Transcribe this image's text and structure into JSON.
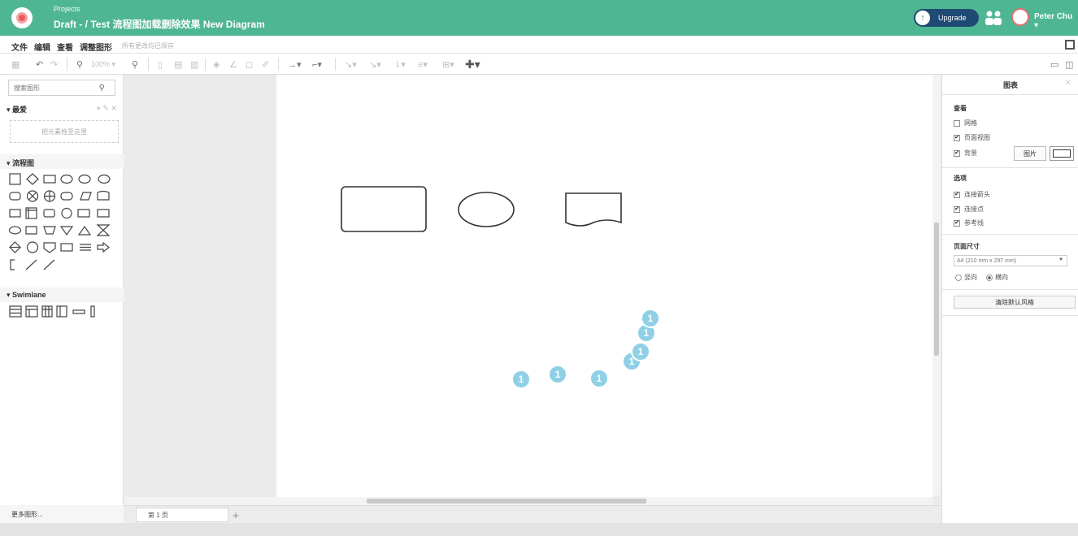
{
  "header": {
    "projects_label": "Projects",
    "doc_title": "Draft - / Test 流程图加载删除效果 New Diagram",
    "upgrade_label": "Upgrade",
    "user_name": "Peter Chu"
  },
  "menubar": {
    "items": [
      "文件",
      "编辑",
      "查看",
      "调整图形"
    ],
    "save_status": "所有更改均已保存"
  },
  "toolbar": {
    "zoom": "100%"
  },
  "sidebar": {
    "search_placeholder": "搜索图形",
    "favorites_title": "最爱",
    "drop_hint": "把元素拖至这里",
    "flowchart_title": "流程图",
    "swimlane_title": "Swimlane",
    "more_shapes": "更多图形..."
  },
  "pagebar": {
    "page_tab": "第 1 页",
    "add_page": "+"
  },
  "format_panel": {
    "title": "图表",
    "view_label": "查看",
    "grid_label": "网格",
    "page_view_label": "页面视图",
    "background_label": "背景",
    "image_button": "图片",
    "options_label": "选项",
    "connection_arrows_label": "连接箭头",
    "connection_points_label": "连接点",
    "guides_label": "参考线",
    "page_size_label": "页面尺寸",
    "page_size_value": "A4 (210 mm x 297 mm)",
    "portrait_label": "竖向",
    "landscape_label": "横向",
    "reset_style_button": "清除默认风格",
    "checks": {
      "grid": false,
      "page_view": true,
      "background": true,
      "connection_arrows": true,
      "connection_points": true,
      "guides": true
    },
    "orientation": "landscape"
  },
  "canvas": {
    "markers": [
      "1",
      "1",
      "1",
      "1",
      "1",
      "1",
      "1"
    ]
  },
  "colors": {
    "header_bg": "#4fb693",
    "upgrade_bg": "#1f4a74",
    "marker": "#8fd0e6"
  }
}
